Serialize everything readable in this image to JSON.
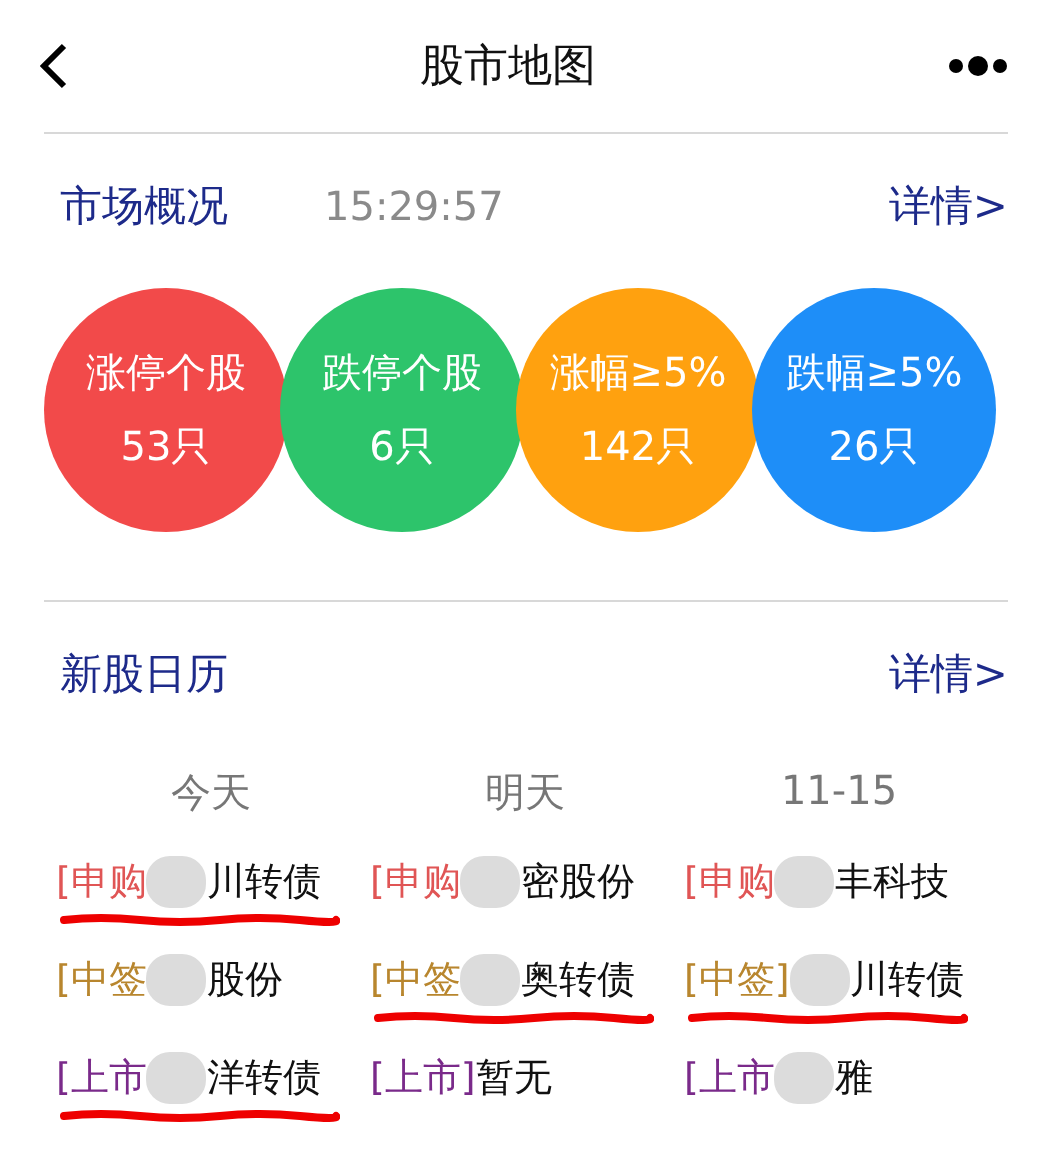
{
  "header": {
    "title": "股市地图"
  },
  "market": {
    "title": "市场概况",
    "time": "15:29:57",
    "link": "详情>",
    "stats": [
      {
        "label": "涨停个股",
        "count": "53只",
        "color": "#f24a4a"
      },
      {
        "label": "跌停个股",
        "count": "6只",
        "color": "#2dc46b"
      },
      {
        "label": "涨幅≥5%",
        "count": "142只",
        "color": "#ffa10f"
      },
      {
        "label": "跌幅≥5%",
        "count": "26只",
        "color": "#1e8ef8"
      }
    ]
  },
  "calendar": {
    "title": "新股日历",
    "link": "详情>",
    "days": [
      "今天",
      "明天",
      "11-15"
    ],
    "rows": [
      [
        {
          "kind": "subscribe",
          "tag": "[申购",
          "blurred": true,
          "name": "川转债",
          "underlined": true
        },
        {
          "kind": "subscribe",
          "tag": "[申购",
          "blurred": true,
          "name": "密股份",
          "underlined": false
        },
        {
          "kind": "subscribe",
          "tag": "[申购",
          "blurred": true,
          "name": "丰科技",
          "underlined": false
        }
      ],
      [
        {
          "kind": "allotted",
          "tag": "[中签",
          "blurred": true,
          "name": "股份",
          "underlined": false
        },
        {
          "kind": "allotted",
          "tag": "[中签",
          "blurred": true,
          "name": "奥转债",
          "underlined": true
        },
        {
          "kind": "allotted",
          "tag": "[中签]",
          "blurred": true,
          "name": "川转债",
          "underlined": true
        }
      ],
      [
        {
          "kind": "listing",
          "tag": "[上市",
          "blurred": true,
          "name": "洋转债",
          "underlined": true
        },
        {
          "kind": "listing",
          "tag": "[上市]",
          "blurred": false,
          "name": "暂无",
          "underlined": false
        },
        {
          "kind": "listing",
          "tag": "[上市",
          "blurred": true,
          "name": "雅",
          "underlined": false
        }
      ]
    ]
  }
}
